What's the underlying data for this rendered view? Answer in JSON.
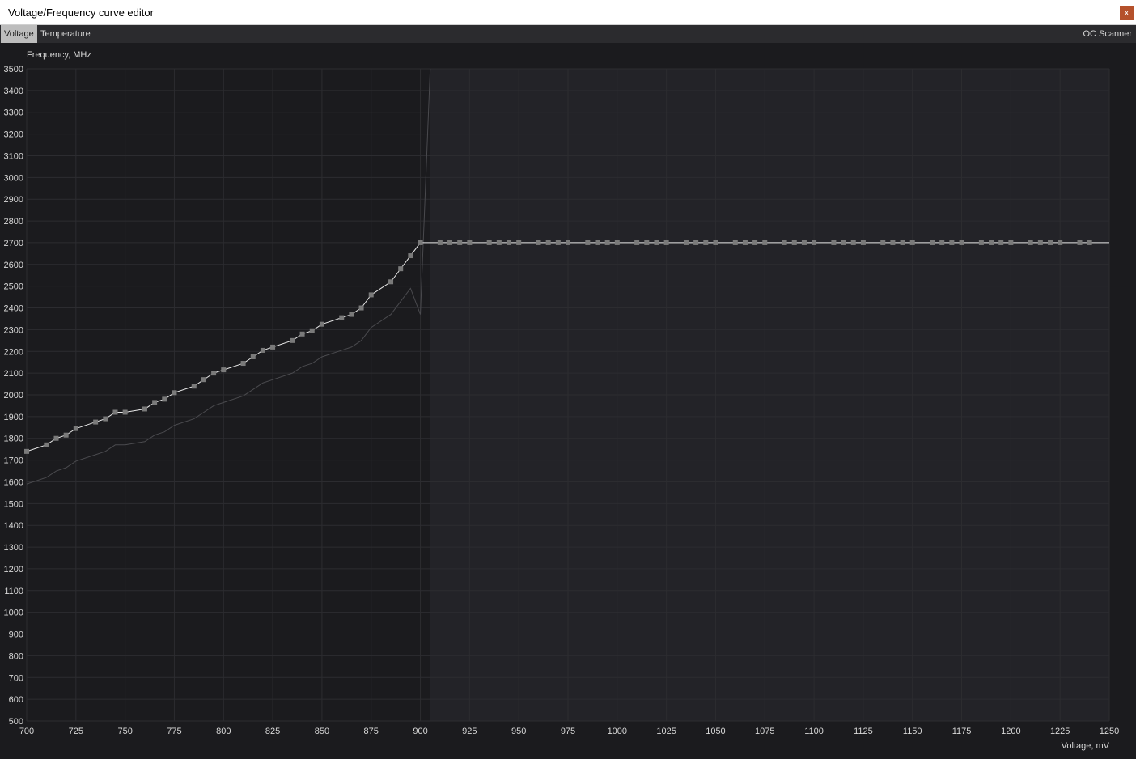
{
  "window": {
    "title": "Voltage/Frequency curve editor",
    "close_label": "x"
  },
  "tabs": [
    {
      "label": "Voltage",
      "active": true
    },
    {
      "label": "Temperature",
      "active": false
    }
  ],
  "oc_scanner_label": "OC Scanner",
  "colors": {
    "background": "#1b1b1e",
    "locked_region": "#232328",
    "grid": "#2c2c30",
    "curve": "#e8e8e8",
    "baseline": "#4a4a4e",
    "point": "#7a7a7a",
    "axis_text": "#d8d8d8",
    "close_button": "#b5512b"
  },
  "chart_data": {
    "type": "line",
    "xlabel": "Voltage, mV",
    "ylabel": "Frequency, MHz",
    "xlim": [
      700,
      1250
    ],
    "ylim": [
      500,
      3500
    ],
    "x_ticks": [
      700,
      725,
      750,
      775,
      800,
      825,
      850,
      875,
      900,
      925,
      950,
      975,
      1000,
      1025,
      1050,
      1075,
      1100,
      1125,
      1150,
      1175,
      1200,
      1225,
      1250
    ],
    "y_ticks": [
      500,
      600,
      700,
      800,
      900,
      1000,
      1100,
      1200,
      1300,
      1400,
      1500,
      1600,
      1700,
      1800,
      1900,
      2000,
      2100,
      2200,
      2300,
      2400,
      2500,
      2600,
      2700,
      2800,
      2900,
      3000,
      3100,
      3200,
      3300,
      3400,
      3500
    ],
    "grid": true,
    "locked_voltage_from": 905,
    "series": [
      {
        "x": [
          700,
          710,
          715,
          720,
          725,
          735,
          740,
          745,
          750,
          760,
          765,
          770,
          775,
          785,
          790,
          795,
          800,
          810,
          815,
          820,
          825,
          835,
          840,
          845,
          850,
          860,
          865,
          870,
          875,
          885,
          890,
          895,
          900,
          910,
          915,
          920,
          925,
          935,
          940,
          945,
          950,
          960,
          965,
          970,
          975,
          985,
          990,
          995,
          1000,
          1010,
          1015,
          1020,
          1025,
          1035,
          1040,
          1045,
          1050,
          1060,
          1065,
          1070,
          1075,
          1085,
          1090,
          1095,
          1100,
          1110,
          1115,
          1120,
          1125,
          1135,
          1140,
          1145,
          1150,
          1160,
          1165,
          1170,
          1175,
          1185,
          1190,
          1195,
          1200,
          1210,
          1215,
          1220,
          1225,
          1235,
          1240
        ],
        "values": [
          1740,
          1770,
          1800,
          1815,
          1845,
          1875,
          1890,
          1920,
          1920,
          1935,
          1965,
          1980,
          2010,
          2040,
          2070,
          2100,
          2115,
          2145,
          2175,
          2205,
          2220,
          2250,
          2280,
          2295,
          2325,
          2355,
          2370,
          2400,
          2460,
          2520,
          2580,
          2640,
          2700,
          2700,
          2700,
          2700,
          2700,
          2700,
          2700,
          2700,
          2700,
          2700,
          2700,
          2700,
          2700,
          2700,
          2700,
          2700,
          2700,
          2700,
          2700,
          2700,
          2700,
          2700,
          2700,
          2700,
          2700,
          2700,
          2700,
          2700,
          2700,
          2700,
          2700,
          2700,
          2700,
          2700,
          2700,
          2700,
          2700,
          2700,
          2700,
          2700,
          2700,
          2700,
          2700,
          2700,
          2700,
          2700,
          2700,
          2700,
          2700,
          2700,
          2700,
          2700,
          2700,
          2700,
          2700
        ],
        "extend_to": 1250
      },
      {
        "x": [
          700,
          710,
          715,
          720,
          725,
          735,
          740,
          745,
          750,
          760,
          765,
          770,
          775,
          785,
          790,
          795,
          800,
          810,
          815,
          820,
          825,
          835,
          840,
          845,
          850,
          860,
          865,
          870,
          875,
          885,
          890,
          895,
          900,
          905
        ],
        "values": [
          1590,
          1620,
          1650,
          1665,
          1695,
          1725,
          1740,
          1770,
          1770,
          1785,
          1815,
          1830,
          1860,
          1890,
          1920,
          1950,
          1965,
          1995,
          2025,
          2055,
          2070,
          2100,
          2130,
          2145,
          2175,
          2205,
          2220,
          2250,
          2310,
          2370,
          2430,
          2490,
          2370,
          3500
        ]
      }
    ]
  }
}
